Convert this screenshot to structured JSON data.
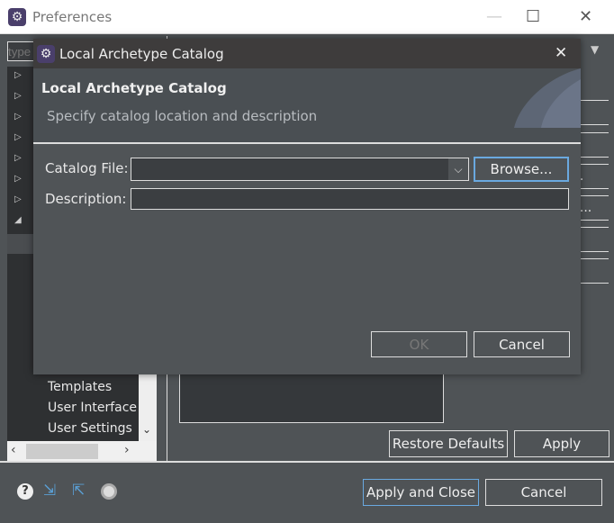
{
  "window": {
    "title": "Preferences",
    "filter_placeholder": "type filter text"
  },
  "tree": {
    "visible_items": [
      "Templates",
      "User Interface",
      "User Settings"
    ]
  },
  "right_buttons": [
    "",
    "",
    "...",
    "g...",
    "",
    ""
  ],
  "page_buttons": {
    "restore_defaults": "Restore Defaults",
    "apply": "Apply"
  },
  "footer": {
    "apply_and_close": "Apply and Close",
    "cancel": "Cancel"
  },
  "dialog": {
    "title": "Local Archetype Catalog",
    "header_title": "Local Archetype Catalog",
    "header_description": "Specify catalog location and description",
    "catalog_file_label": "Catalog File:",
    "catalog_file_value": "",
    "description_label": "Description:",
    "description_value": "",
    "browse": "Browse...",
    "ok": "OK",
    "cancel": "Cancel"
  },
  "colors": {
    "accent_focus": "#6aa9e0",
    "dialog_bg": "#505457",
    "title_bg": "#3e3c3c"
  }
}
